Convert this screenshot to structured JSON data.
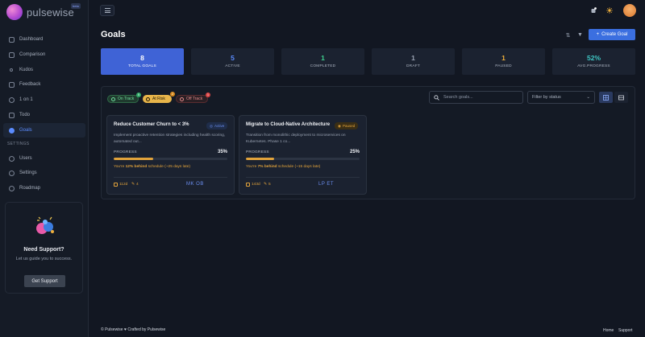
{
  "app": {
    "name": "pulsewise",
    "beta_label": "beta"
  },
  "sidebar": {
    "items": [
      {
        "label": "Dashboard",
        "icon": "dashboard-icon"
      },
      {
        "label": "Comparison",
        "icon": "comparison-icon"
      },
      {
        "label": "Kudos",
        "icon": "kudos-icon"
      },
      {
        "label": "Feedback",
        "icon": "feedback-icon"
      },
      {
        "label": "1 on 1",
        "icon": "one-on-one-icon"
      },
      {
        "label": "Todo",
        "icon": "todo-icon"
      },
      {
        "label": "Goals",
        "icon": "goals-icon",
        "active": true
      }
    ],
    "settings_label": "SETTINGS",
    "settings_items": [
      {
        "label": "Users",
        "icon": "users-icon"
      },
      {
        "label": "Settings",
        "icon": "settings-icon"
      },
      {
        "label": "Roadmap",
        "icon": "roadmap-icon"
      }
    ],
    "support": {
      "title": "Need Support?",
      "text": "Let us guide you to success.",
      "button": "Get Support"
    }
  },
  "page": {
    "title": "Goals",
    "create_button": "Create Goal"
  },
  "stats": [
    {
      "value": "8",
      "label": "TOTAL GOALS",
      "color": "#ffffff"
    },
    {
      "value": "5",
      "label": "ACTIVE",
      "color": "#5b8cff"
    },
    {
      "value": "1",
      "label": "COMPLETED",
      "color": "#3fcf8e"
    },
    {
      "value": "1",
      "label": "DRAFT",
      "color": "#9aa3b3"
    },
    {
      "value": "1",
      "label": "PAUSED",
      "color": "#f0b03c"
    },
    {
      "value": "52%",
      "label": "AVG.PROGRESS",
      "color": "#3fc7c4"
    }
  ],
  "filters": {
    "on_track": {
      "label": "On Track",
      "count": "5"
    },
    "at_risk": {
      "label": "At Risk",
      "count": "2"
    },
    "off_track": {
      "label": "Off Track",
      "count": "1"
    },
    "search_placeholder": "Search goals...",
    "status_select": "Filter by status"
  },
  "goals": [
    {
      "title": "Reduce Customer Churn to < 3%",
      "status": "Active",
      "description": "Implement proactive retention strategies including health scoring, automated out...",
      "progress_label": "PROGRESS",
      "progress_text": "35%",
      "progress": 0.35,
      "behind_prefix": "You're ",
      "behind_pct": "12% behind",
      "behind_suffix": " schedule (~25 days late)",
      "days": "112d",
      "comments": "4",
      "owners": "MK OB"
    },
    {
      "title": "Migrate to Cloud-Native Architecture",
      "status": "Paused",
      "description": "Transition from monolithic deployment to microservices on Kubernetes. Phase 1 co...",
      "progress_label": "PROGRESS",
      "progress_text": "25%",
      "progress": 0.25,
      "behind_prefix": "You're ",
      "behind_pct": "7% behind",
      "behind_suffix": " schedule (~15 days late)",
      "days": "143d",
      "comments": "5",
      "owners": "LP ET"
    }
  ],
  "footer": {
    "left": "© Pulsewise ♥ Crafted by Pulsewise",
    "home": "Home",
    "support": "Support"
  }
}
